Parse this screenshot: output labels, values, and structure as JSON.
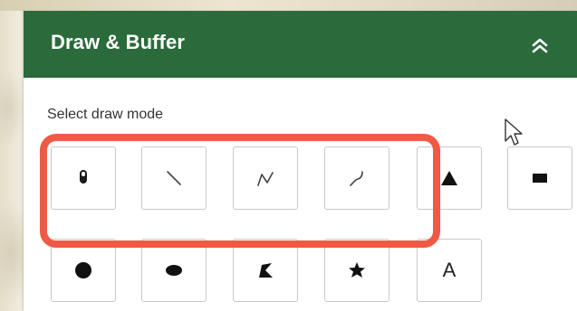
{
  "panel": {
    "title": "Draw & Buffer",
    "header_color": "#2b6a3b"
  },
  "draw": {
    "label": "Select draw mode",
    "highlight_color": "#ee5a45",
    "row1": [
      {
        "icon": "point-icon"
      },
      {
        "icon": "line-icon"
      },
      {
        "icon": "polyline-icon"
      },
      {
        "icon": "freehand-line-icon"
      },
      {
        "icon": "triangle-icon"
      },
      {
        "icon": "rectangle-icon"
      }
    ],
    "row2": [
      {
        "icon": "circle-icon"
      },
      {
        "icon": "ellipse-icon"
      },
      {
        "icon": "polygon-icon"
      },
      {
        "icon": "freehand-polygon-icon"
      },
      {
        "icon": "text-icon",
        "glyph": "A"
      }
    ]
  }
}
